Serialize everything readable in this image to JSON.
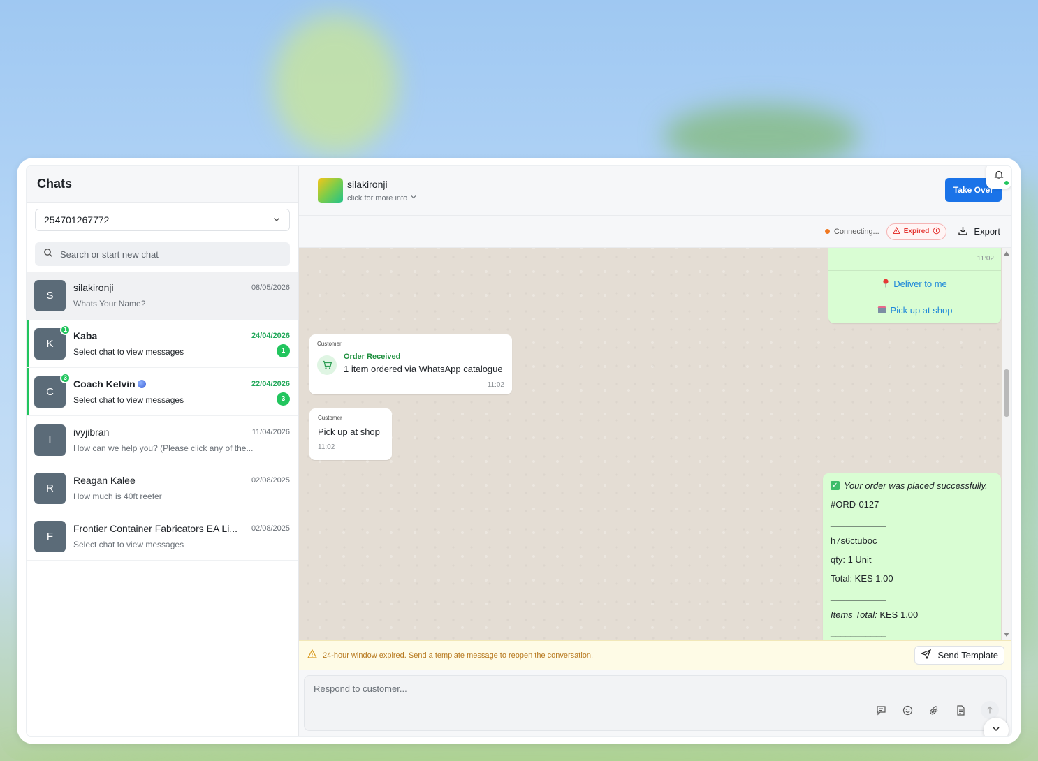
{
  "sidebar": {
    "title": "Chats",
    "phone_number": "254701267772",
    "search_placeholder": "Search or start new chat",
    "chats": [
      {
        "initial": "S",
        "name": "silakironji",
        "date": "08/05/2026",
        "preview": "Whats Your Name?",
        "unread": null
      },
      {
        "initial": "K",
        "name": "Kaba",
        "date": "24/04/2026",
        "preview": "Select chat to view messages",
        "unread": "1"
      },
      {
        "initial": "C",
        "name": "Coach Kelvin",
        "date": "22/04/2026",
        "preview": "Select chat to view messages",
        "unread": "3"
      },
      {
        "initial": "I",
        "name": "ivyjibran",
        "date": "11/04/2026",
        "preview": "How can we help you? (Please click any of the...",
        "unread": null
      },
      {
        "initial": "R",
        "name": "Reagan Kalee",
        "date": "02/08/2025",
        "preview": "How much is 40ft reefer",
        "unread": null
      },
      {
        "initial": "F",
        "name": "Frontier Container Fabricators EA Li...",
        "date": "02/08/2025",
        "preview": "Select chat to view messages",
        "unread": null
      }
    ]
  },
  "header": {
    "contact_name": "silakironji",
    "contact_sub": "click for more info",
    "take_over_label": "Take Over"
  },
  "status": {
    "connecting": "Connecting...",
    "expired": "Expired",
    "export_label": "Export"
  },
  "messages": {
    "out_top_time": "11:02",
    "quick_replies": [
      "Deliver to me",
      "Pick up at shop"
    ],
    "order": {
      "label": "Customer",
      "title": "Order Received",
      "desc": "1 item ordered via WhatsApp catalogue",
      "time": "11:02"
    },
    "pick": {
      "label": "Customer",
      "text": "Pick up at shop",
      "time": "11:02"
    },
    "success": {
      "headline": "Your order was placed successfully.",
      "order_id": "#ORD-0127",
      "divider": "___________",
      "item": "h7s6ctuboc",
      "qty": "qty: 1 Unit",
      "total": "Total: KES 1.00",
      "items_total_label": "Items Total:",
      "items_total_value": "KES 1.00"
    }
  },
  "warning": {
    "text": "24-hour window expired. Send a template message to reopen the conversation.",
    "send_template_label": "Send Template"
  },
  "composer": {
    "placeholder": "Respond to customer..."
  },
  "colors": {
    "accent": "#1a73e8",
    "unread": "#22c55e",
    "outgoing_bubble": "#d9fdd3",
    "warning": "#b7791f",
    "expired": "#e53935"
  }
}
